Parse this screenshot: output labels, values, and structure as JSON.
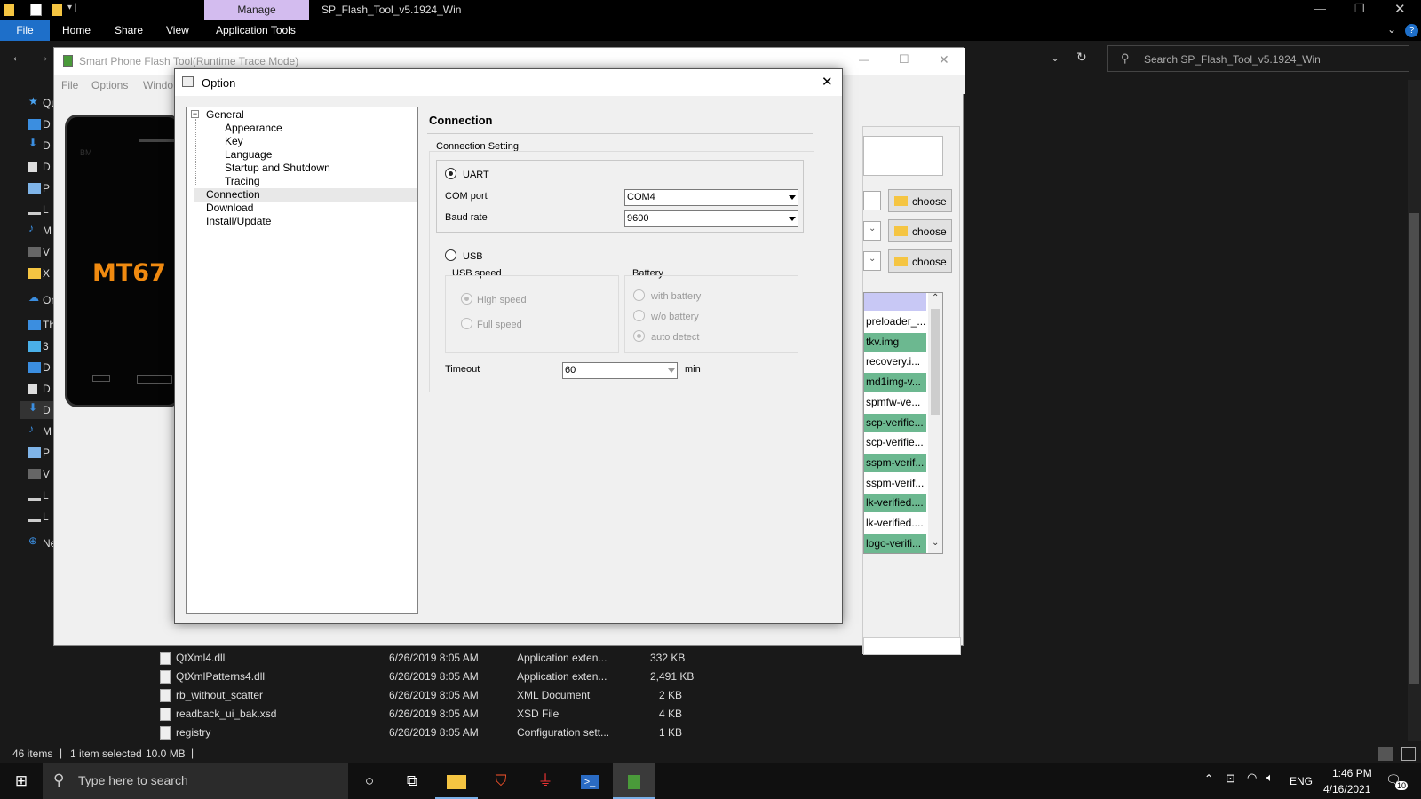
{
  "explorer": {
    "title": "SP_Flash_Tool_v5.1924_Win",
    "manage_tab": "Manage",
    "ribbon_tabs": [
      "File",
      "Home",
      "Share",
      "View",
      "Application Tools"
    ],
    "search_placeholder": "Search SP_Flash_Tool_v5.1924_Win",
    "nav_items": [
      "Qu",
      "D",
      "D",
      "D",
      "P",
      "L",
      "M",
      "V",
      "X",
      "On",
      "Thi",
      "3",
      "D",
      "D",
      "D",
      "M",
      "P",
      "V",
      "L",
      "L",
      "Ne"
    ],
    "files": [
      {
        "name": "QtXml4.dll",
        "date": "6/26/2019 8:05 AM",
        "type": "Application exten...",
        "size": "332 KB"
      },
      {
        "name": "QtXmlPatterns4.dll",
        "date": "6/26/2019 8:05 AM",
        "type": "Application exten...",
        "size": "2,491 KB"
      },
      {
        "name": "rb_without_scatter",
        "date": "6/26/2019 8:05 AM",
        "type": "XML Document",
        "size": "2 KB"
      },
      {
        "name": "readback_ui_bak.xsd",
        "date": "6/26/2019 8:05 AM",
        "type": "XSD File",
        "size": "4 KB"
      },
      {
        "name": "registry",
        "date": "6/26/2019 8:05 AM",
        "type": "Configuration sett...",
        "size": "1 KB"
      }
    ],
    "status": {
      "items": "46 items",
      "selected": "1 item selected",
      "size": "10.0 MB"
    }
  },
  "flashtool": {
    "title": "Smart Phone Flash Tool(Runtime Trace Mode)",
    "menu": [
      "File",
      "Options",
      "Windo"
    ],
    "phone_text": "MT67",
    "phone_brand": "BM",
    "choose_label": "choose",
    "partitions": [
      "preloader_...",
      "tkv.img",
      "recovery.i...",
      "md1img-v...",
      "spmfw-ve...",
      "scp-verifie...",
      "scp-verifie...",
      "sspm-verif...",
      "sspm-verif...",
      "lk-verified....",
      "lk-verified....",
      "logo-verifi..."
    ],
    "partition_highlight": [
      false,
      true,
      false,
      true,
      false,
      true,
      false,
      true,
      false,
      true,
      false,
      true
    ]
  },
  "dialog": {
    "title": "Option",
    "tree": {
      "general": "General",
      "appearance": "Appearance",
      "key": "Key",
      "language": "Language",
      "startup": "Startup and Shutdown",
      "tracing": "Tracing",
      "connection": "Connection",
      "download": "Download",
      "install": "Install/Update"
    },
    "heading": "Connection",
    "connection_setting": "Connection Setting",
    "uart": "UART",
    "com_port_label": "COM port",
    "com_port_value": "COM4",
    "baud_label": "Baud rate",
    "baud_value": "9600",
    "usb": "USB",
    "usb_speed": "USB speed",
    "high_speed": "High speed",
    "full_speed": "Full speed",
    "battery": "Battery",
    "with_battery": "with battery",
    "wo_battery": "w/o battery",
    "auto_detect": "auto detect",
    "timeout_label": "Timeout",
    "timeout_value": "60",
    "timeout_unit": "min"
  },
  "taskbar": {
    "search_placeholder": "Type here to search",
    "lang": "ENG",
    "time": "1:46 PM",
    "date": "4/16/2021",
    "notifications": "10"
  },
  "colors": {
    "accent": "#1e6fc9",
    "manage": "#d3bcef",
    "highlight_green": "#6cb890",
    "phone_text": "#f08a10"
  }
}
